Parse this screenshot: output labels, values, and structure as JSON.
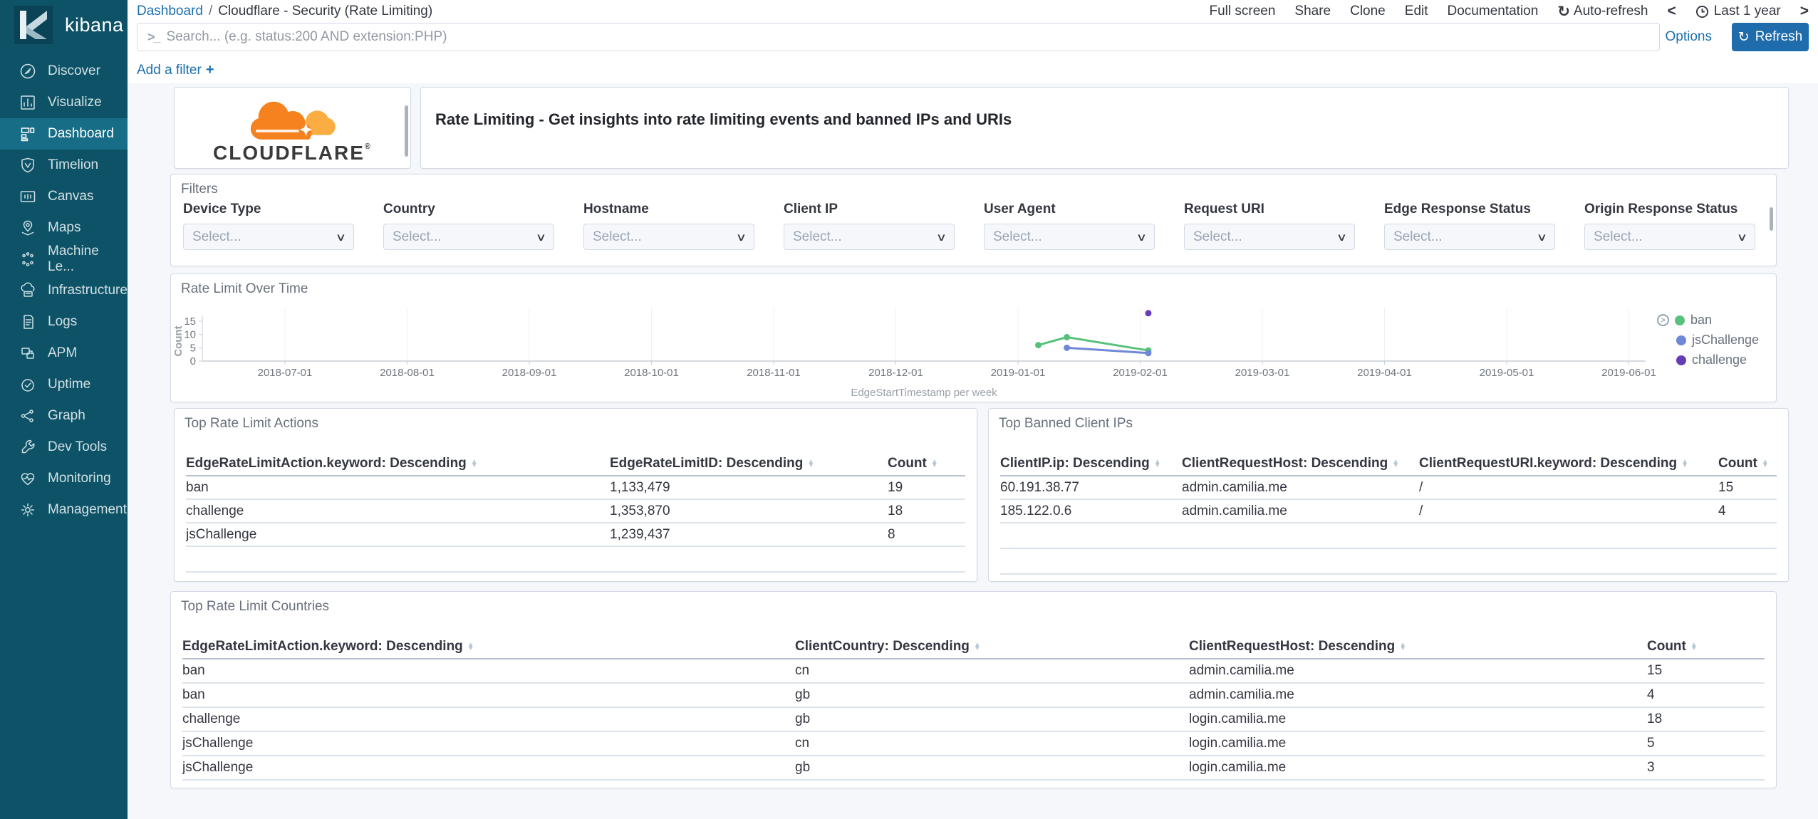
{
  "chrome": {
    "logo_text": "kibana",
    "breadcrumb": {
      "root": "Dashboard",
      "separator": "/",
      "current": "Cloudflare - Security (Rate Limiting)"
    },
    "top_menu": [
      "Full screen",
      "Share",
      "Clone",
      "Edit",
      "Documentation"
    ],
    "auto_refresh": {
      "icon": "↻",
      "label": "Auto-refresh"
    },
    "time_picker": {
      "prev": "<",
      "label": "Last 1 year",
      "next": ">"
    },
    "search": {
      "prompt": ">_",
      "placeholder": "Search... (e.g. status:200 AND extension:PHP)"
    },
    "options_label": "Options",
    "refresh": {
      "icon": "↻",
      "label": "Refresh"
    },
    "add_filter": {
      "label": "Add a filter",
      "plus": "+"
    }
  },
  "sidebar": {
    "items": [
      {
        "label": "Discover",
        "icon": "discover",
        "active": false
      },
      {
        "label": "Visualize",
        "icon": "visualize",
        "active": false
      },
      {
        "label": "Dashboard",
        "icon": "dashboard",
        "active": true
      },
      {
        "label": "Timelion",
        "icon": "timelion",
        "active": false
      },
      {
        "label": "Canvas",
        "icon": "canvas",
        "active": false
      },
      {
        "label": "Maps",
        "icon": "maps",
        "active": false
      },
      {
        "label": "Machine Le...",
        "icon": "machine-learning",
        "active": false
      },
      {
        "label": "Infrastructure",
        "icon": "infrastructure",
        "active": false
      },
      {
        "label": "Logs",
        "icon": "logs",
        "active": false
      },
      {
        "label": "APM",
        "icon": "apm",
        "active": false
      },
      {
        "label": "Uptime",
        "icon": "uptime",
        "active": false
      },
      {
        "label": "Graph",
        "icon": "graph",
        "active": false
      },
      {
        "label": "Dev Tools",
        "icon": "dev-tools",
        "active": false
      },
      {
        "label": "Monitoring",
        "icon": "monitoring",
        "active": false
      },
      {
        "label": "Management",
        "icon": "management",
        "active": false
      }
    ]
  },
  "panels": {
    "logo": {
      "brand": "CLOUDFLARE",
      "reg": "®"
    },
    "markdown": {
      "text": "Rate Limiting - Get insights into rate limiting events and banned IPs and URIs"
    },
    "filters": {
      "title": "Filters",
      "placeholder": "Select...",
      "fields": [
        "Device Type",
        "Country",
        "Hostname",
        "Client IP",
        "User Agent",
        "Request URI",
        "Edge Response Status",
        "Origin Response Status"
      ]
    },
    "actions_table": {
      "title": "Top Rate Limit Actions",
      "columns": [
        "EdgeRateLimitAction.keyword: Descending",
        "EdgeRateLimitID: Descending",
        "Count"
      ],
      "rows": [
        [
          "ban",
          "1,133,479",
          "19"
        ],
        [
          "challenge",
          "1,353,870",
          "18"
        ],
        [
          "jsChallenge",
          "1,239,437",
          "8"
        ]
      ]
    },
    "banned_table": {
      "title": "Top Banned Client IPs",
      "columns": [
        "ClientIP.ip: Descending",
        "ClientRequestHost: Descending",
        "ClientRequestURI.keyword: Descending",
        "Count"
      ],
      "rows": [
        [
          "60.191.38.77",
          "admin.camilia.me",
          "/",
          "15"
        ],
        [
          "185.122.0.6",
          "admin.camilia.me",
          "/",
          "4"
        ]
      ]
    },
    "countries_table": {
      "title": "Top Rate Limit Countries",
      "columns": [
        "EdgeRateLimitAction.keyword: Descending",
        "ClientCountry: Descending",
        "ClientRequestHost: Descending",
        "Count"
      ],
      "rows": [
        [
          "ban",
          "cn",
          "admin.camilia.me",
          "15"
        ],
        [
          "ban",
          "gb",
          "admin.camilia.me",
          "4"
        ],
        [
          "challenge",
          "gb",
          "login.camilia.me",
          "18"
        ],
        [
          "jsChallenge",
          "cn",
          "login.camilia.me",
          "5"
        ],
        [
          "jsChallenge",
          "gb",
          "login.camilia.me",
          "3"
        ]
      ]
    }
  },
  "chart_data": {
    "type": "line",
    "title": "Rate Limit Over Time",
    "xlabel": "EdgeStartTimestamp per week",
    "ylabel": "Count",
    "ylim": [
      0,
      15
    ],
    "yticks": [
      0,
      5,
      10,
      15
    ],
    "x_ticks": [
      "2018-07-01",
      "2018-08-01",
      "2018-09-01",
      "2018-10-01",
      "2018-11-01",
      "2018-12-01",
      "2019-01-01",
      "2019-02-01",
      "2019-03-01",
      "2019-04-01",
      "2019-05-01",
      "2019-06-01"
    ],
    "grid": true,
    "legend_position": "right",
    "series": [
      {
        "name": "ban",
        "color": "#57c17b",
        "points": [
          [
            "2019-01-06",
            6
          ],
          [
            "2019-01-13",
            9
          ],
          [
            "2019-02-03",
            4
          ]
        ]
      },
      {
        "name": "jsChallenge",
        "color": "#6f87d8",
        "points": [
          [
            "2019-01-13",
            5
          ],
          [
            "2019-02-03",
            3
          ]
        ]
      },
      {
        "name": "challenge",
        "color": "#663db8",
        "points": [
          [
            "2019-02-03",
            18
          ]
        ]
      }
    ]
  }
}
